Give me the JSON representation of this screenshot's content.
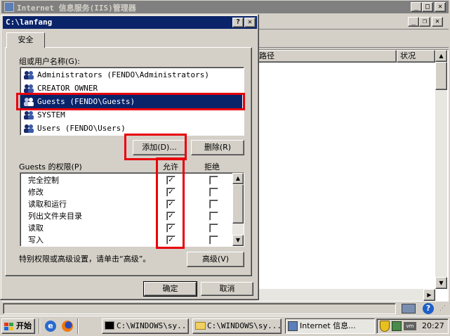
{
  "main_window": {
    "title": "Internet 信息服务(IIS)管理器",
    "list_columns": [
      "路径",
      "状况"
    ]
  },
  "dialog": {
    "title": "C:\\lanfang",
    "tab": "安全",
    "users_label": "组或用户名称(G):",
    "users": [
      "Administrators (FENDO\\Administrators)",
      "CREATOR OWNER",
      "Guests (FENDO\\Guests)",
      "SYSTEM",
      "Users (FENDO\\Users)"
    ],
    "add_button": "添加(D)...",
    "remove_button": "删除(R)",
    "perm_label": "Guests 的权限(P)",
    "allow_header": "允许",
    "deny_header": "拒绝",
    "permissions": [
      {
        "name": "完全控制",
        "allow": true,
        "deny": false
      },
      {
        "name": "修改",
        "allow": true,
        "deny": false
      },
      {
        "name": "读取和运行",
        "allow": true,
        "deny": false
      },
      {
        "name": "列出文件夹目录",
        "allow": true,
        "deny": false
      },
      {
        "name": "读取",
        "allow": true,
        "deny": false
      },
      {
        "name": "写入",
        "allow": true,
        "deny": false
      }
    ],
    "advanced_text": "特别权限或高级设置，请单击“高级”。",
    "advanced_button": "高级(V)",
    "ok_button": "确定",
    "cancel_button": "取消"
  },
  "taskbar": {
    "start": "开始",
    "tasks": [
      "C:\\WINDOWS\\sy...",
      "C:\\WINDOWS\\sy...",
      "Internet 信息..."
    ],
    "clock": "20:27"
  },
  "colors": {
    "titlebar_active": "#0a246a",
    "titlebar_inactive": "#808080",
    "selection": "#0a246a",
    "highlight_box": "#e8000b",
    "desktop_gray": "#d4d0c8"
  }
}
